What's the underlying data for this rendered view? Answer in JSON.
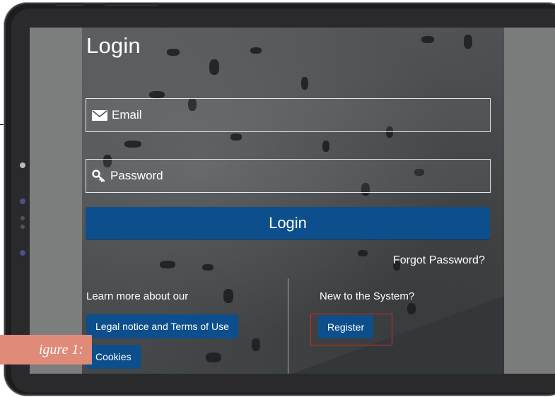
{
  "login_title": "Login",
  "email": {
    "placeholder": "Email",
    "icon": "envelope-icon"
  },
  "password": {
    "placeholder": "Password",
    "icon": "key-icon"
  },
  "login_button": "Login",
  "forgot_password": "Forgot Password?",
  "learn_more": {
    "text": "Learn more about our",
    "legal_button": "Legal notice and Terms of Use",
    "cookies_button": "Cookies"
  },
  "new_user": {
    "text": "New to the System?",
    "register_button": "Register"
  },
  "figure_caption": "igure 1:",
  "colors": {
    "primary_button": "#0c4f8c",
    "highlight_border": "#d12b2b",
    "caption_background": "#e08a7a"
  }
}
